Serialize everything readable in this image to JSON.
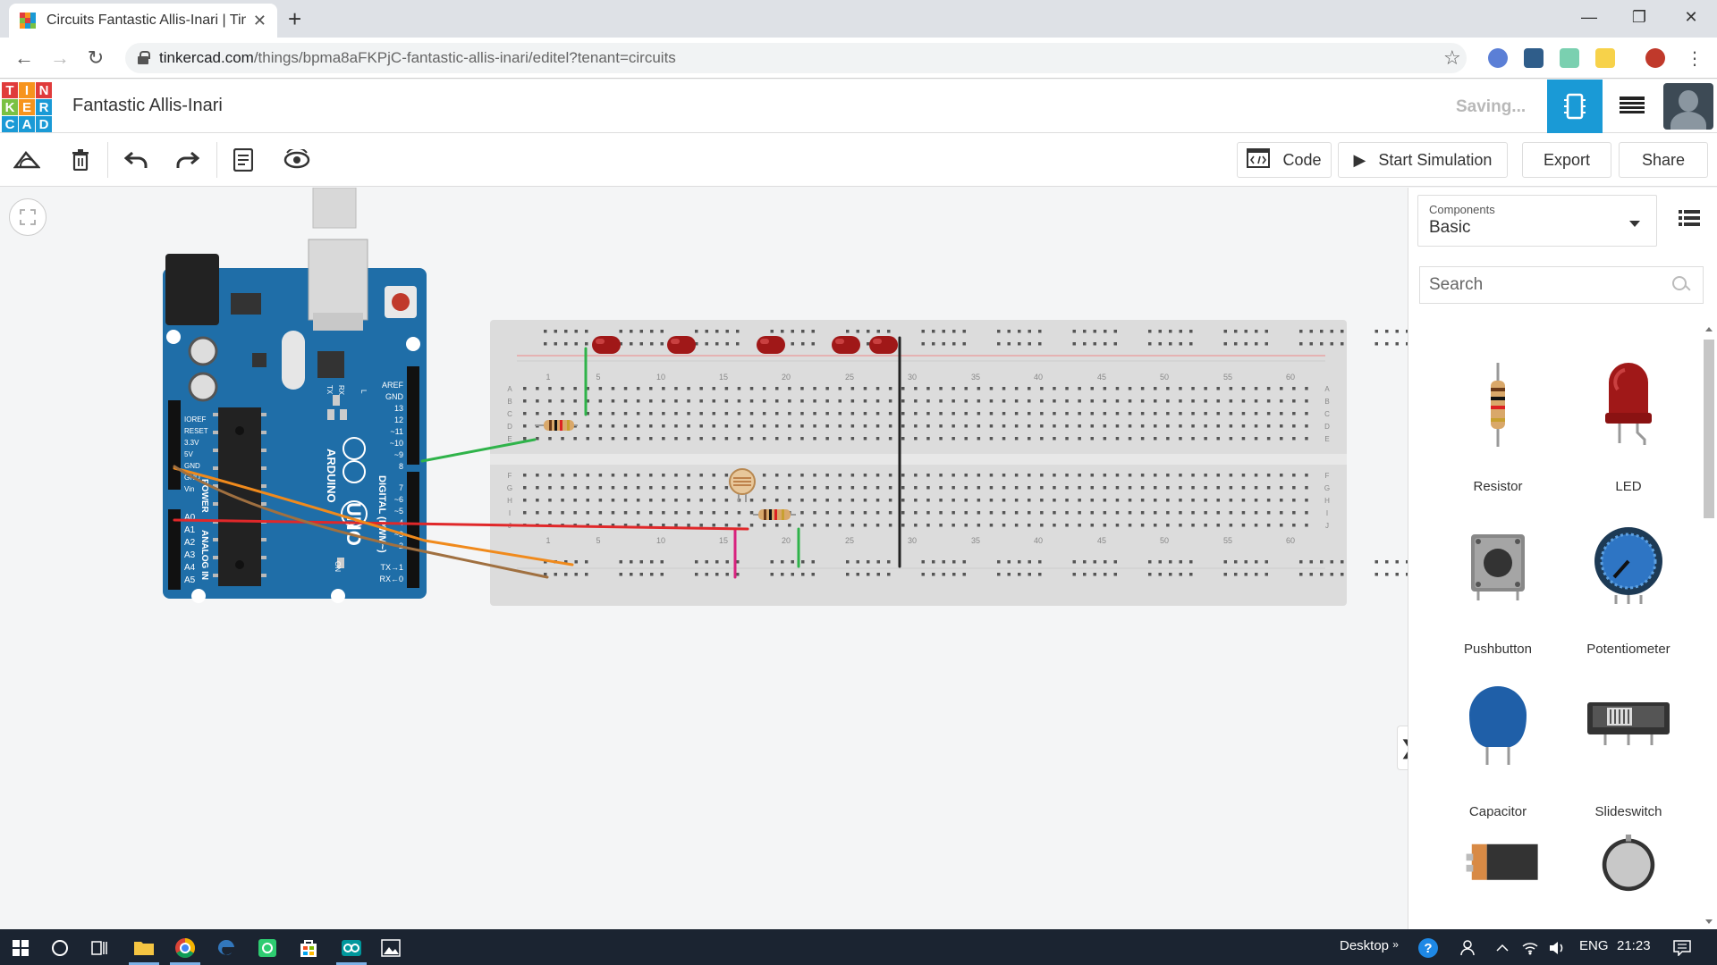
{
  "browser": {
    "tab_title": "Circuits Fantastic Allis-Inari | Tink",
    "url_host": "tinkercad.com",
    "url_path": "/things/bpma8aFKPjC-fantastic-allis-inari/editel?tenant=circuits"
  },
  "app": {
    "logo_letters": [
      "T",
      "I",
      "N",
      "K",
      "E",
      "R",
      "C",
      "A",
      "D"
    ],
    "project_name": "Fantastic Allis-Inari",
    "save_status": "Saving..."
  },
  "toolbar": {
    "code_label": "Code",
    "start_sim_label": "Start Simulation",
    "export_label": "Export",
    "share_label": "Share"
  },
  "panel": {
    "components_label": "Components",
    "components_value": "Basic",
    "search_placeholder": "Search",
    "components": [
      {
        "name": "Resistor",
        "icon": "resistor-icon"
      },
      {
        "name": "LED",
        "icon": "led-icon"
      },
      {
        "name": "Pushbutton",
        "icon": "pushbutton-icon"
      },
      {
        "name": "Potentiometer",
        "icon": "potentiometer-icon"
      },
      {
        "name": "Capacitor",
        "icon": "capacitor-icon"
      },
      {
        "name": "Slideswitch",
        "icon": "slideswitch-icon"
      }
    ]
  },
  "breadboard": {
    "col_labels": [
      "1",
      "5",
      "10",
      "15",
      "20",
      "25",
      "30",
      "35",
      "40",
      "45",
      "50",
      "55",
      "60"
    ],
    "row_labels_top": [
      "A",
      "B",
      "C",
      "D",
      "E"
    ],
    "row_labels_bottom": [
      "F",
      "G",
      "H",
      "I",
      "J"
    ]
  },
  "arduino": {
    "brand": "ARDUINO",
    "model": "UNO",
    "digital_label": "DIGITAL (PWM~)",
    "power_label": "POWER",
    "analog_label": "ANALOG IN",
    "power_pins": [
      "IOREF",
      "RESET",
      "3.3V",
      "5V",
      "GND",
      "GND",
      "Vin"
    ],
    "analog_pins": [
      "A0",
      "A1",
      "A2",
      "A3",
      "A4",
      "A5"
    ],
    "digital_pins": [
      "AREF",
      "GND",
      "13",
      "12",
      "~11",
      "~10",
      "~9",
      "8",
      "7",
      "~6",
      "~5",
      "4",
      "~3",
      "2",
      "TX→1",
      "RX←0"
    ],
    "on_label": "ON",
    "tx_label": "TX",
    "rx_label": "RX",
    "l_label": "L"
  },
  "taskbar": {
    "desktop_label": "Desktop",
    "lang": "ENG",
    "time": "21:23"
  },
  "colors": {
    "accent": "#1a9ad6",
    "board": "#1f6ea8",
    "breadboard": "#dcdcdc",
    "led": "#a01818"
  }
}
